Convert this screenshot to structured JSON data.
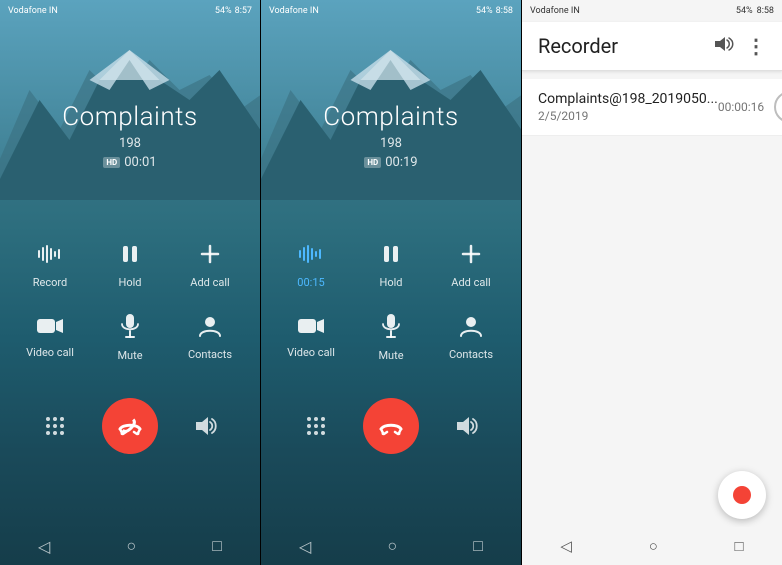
{
  "phone1": {
    "status_bar": {
      "carrier": "Vodafone IN",
      "time": "8:57",
      "battery": "54%"
    },
    "call": {
      "name": "Complaints",
      "number": "198",
      "duration": "00:01",
      "hd": "HD"
    },
    "actions_row1": [
      {
        "id": "record",
        "label": "Record",
        "icon": "🎙"
      },
      {
        "id": "hold",
        "label": "Hold",
        "icon": "⏸"
      },
      {
        "id": "add_call",
        "label": "Add call",
        "icon": "+"
      }
    ],
    "actions_row2": [
      {
        "id": "video_call",
        "label": "Video call",
        "icon": "🎥"
      },
      {
        "id": "mute",
        "label": "Mute",
        "icon": "🎤"
      },
      {
        "id": "contacts",
        "label": "Contacts",
        "icon": "👤"
      }
    ],
    "controls": {
      "dialpad": "⌨",
      "end_call": "📞",
      "speaker": "🔊"
    },
    "nav": [
      "◁",
      "○",
      "□"
    ]
  },
  "phone2": {
    "status_bar": {
      "carrier": "Vodafone IN",
      "time": "8:58",
      "battery": "54%"
    },
    "call": {
      "name": "Complaints",
      "number": "198",
      "duration": "00:19",
      "hd": "HD"
    },
    "actions_row1": [
      {
        "id": "record",
        "label": "00:15",
        "icon": "🎙",
        "active": true
      },
      {
        "id": "hold",
        "label": "Hold",
        "icon": "⏸"
      },
      {
        "id": "add_call",
        "label": "Add call",
        "icon": "+"
      }
    ],
    "actions_row2": [
      {
        "id": "video_call",
        "label": "Video call",
        "icon": "🎥"
      },
      {
        "id": "mute",
        "label": "Mute",
        "icon": "🎤"
      },
      {
        "id": "contacts",
        "label": "Contacts",
        "icon": "👤"
      }
    ],
    "controls": {
      "dialpad": "⌨",
      "end_call": "📞",
      "speaker": "🔊"
    },
    "nav": [
      "◁",
      "○",
      "□"
    ]
  },
  "recorder": {
    "status_bar": {
      "carrier": "Vodafone IN",
      "time": "8:58",
      "battery": "54%"
    },
    "title": "Recorder",
    "recording": {
      "name": "Complaints@198_2019050...",
      "date": "2/5/2019",
      "duration": "00:00:16"
    },
    "nav": [
      "◁",
      "○",
      "□"
    ],
    "icons": {
      "volume": "🔊",
      "more": "⋮",
      "play": "▶"
    }
  }
}
